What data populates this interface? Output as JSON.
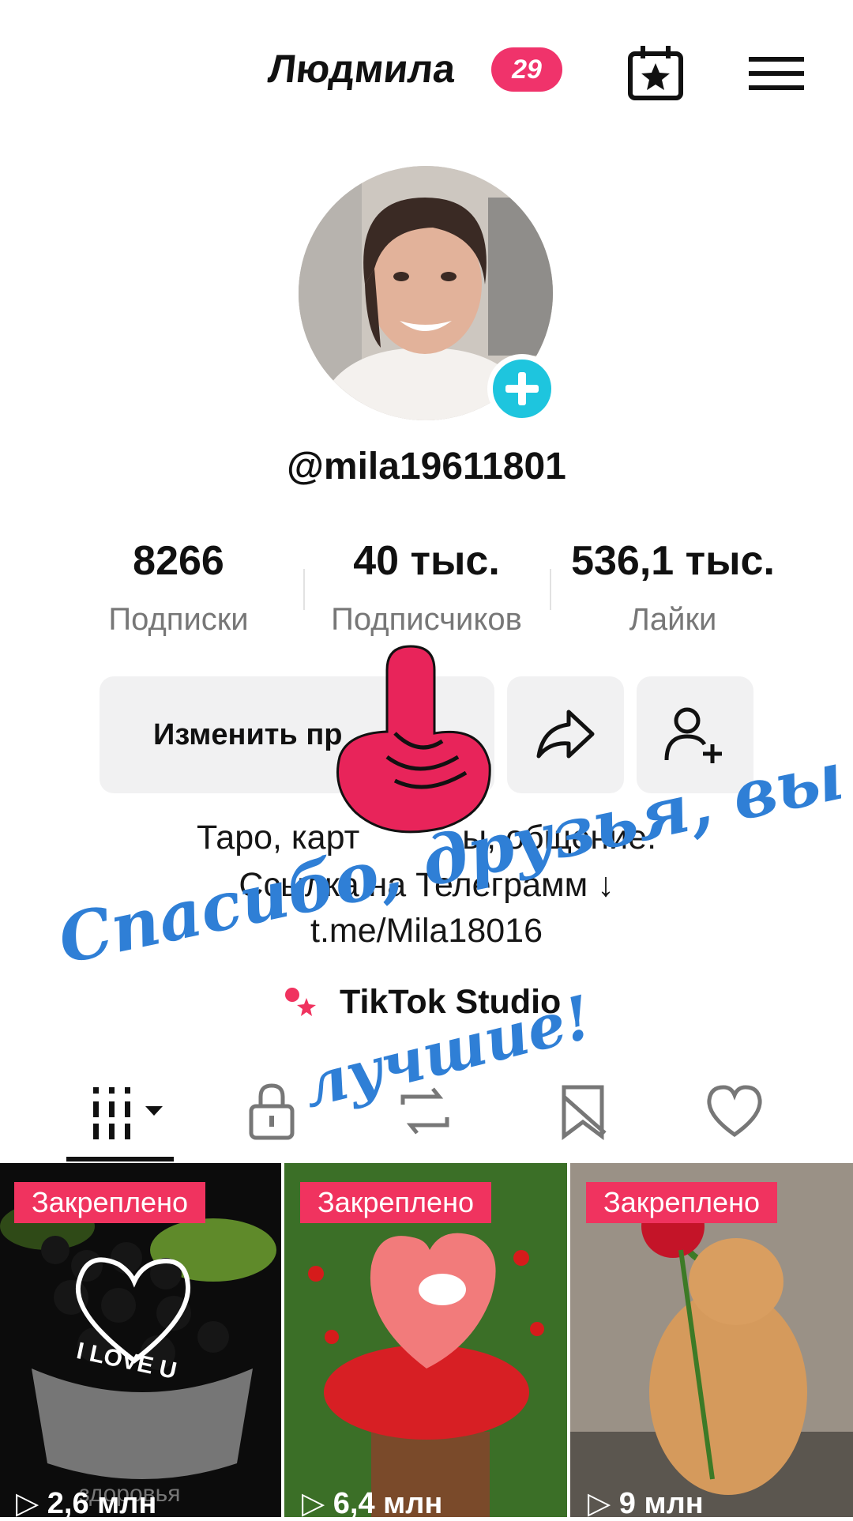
{
  "header": {
    "name": "Людмила",
    "badge": "29",
    "calendar_icon": "calendar-star-icon",
    "menu_icon": "menu-icon"
  },
  "profile": {
    "username": "@mila19611801",
    "stats": [
      {
        "value": "8266",
        "label": "Подписки"
      },
      {
        "value": "40 тыс.",
        "label": "Подписчиков"
      },
      {
        "value": "536,1 тыс.",
        "label": "Лайки"
      }
    ],
    "edit_button": "Изменить пр",
    "bio_lines": [
      "Таро, карт",
      "ы, общение.",
      "Ссылка на Телеграмм ↓",
      "t.me/Mila18016"
    ],
    "studio_label": "TikTok Studio"
  },
  "overlay": {
    "line1": "Спасибо, друзья, вы",
    "line2": "лучшие!"
  },
  "tabs": [
    "grid-icon",
    "lock-icon",
    "repost-icon",
    "bookmark-icon",
    "heart-icon"
  ],
  "videos": [
    {
      "pinned": "Закреплено",
      "views": "2,6 млн",
      "caption": "I LOVE U",
      "caption2": "здоровья"
    },
    {
      "pinned": "Закреплено",
      "views": "6,4 млн"
    },
    {
      "pinned": "Закреплено",
      "views": "9 млн"
    }
  ],
  "colors": {
    "accent": "#f0335f",
    "plus": "#1ec5de",
    "handwriting": "#2f7fd6"
  }
}
